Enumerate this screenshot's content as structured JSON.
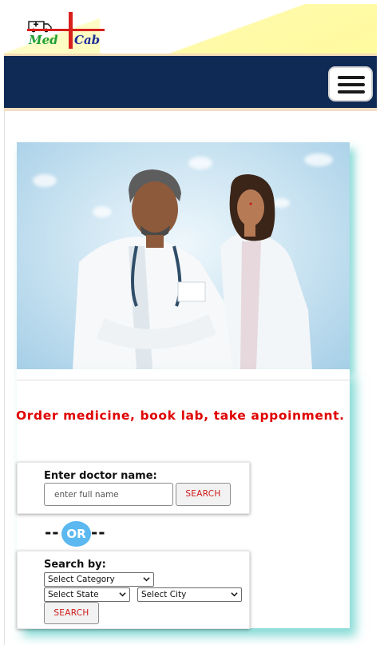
{
  "brand": {
    "logo_left": "Med",
    "logo_right": "Cab",
    "colors": {
      "med": "#1e9f31",
      "cab": "#1f2f96",
      "cross": "#d7201c"
    }
  },
  "navbar": {
    "color": "#0e2a55",
    "menu_icon": "hamburger-menu-icon"
  },
  "hero": {
    "image": "two-doctors-photo"
  },
  "tagline": "Order medicine, book lab, take appoinment.",
  "doctor_search": {
    "label": "Enter doctor name:",
    "placeholder": "enter full name",
    "button": "SEARCH"
  },
  "divider": {
    "left": "--",
    "text": "OR",
    "right": "--"
  },
  "search_by": {
    "label": "Search by:",
    "category": "Select Category",
    "state": "Select State",
    "city": "Select City",
    "button": "SEARCH"
  },
  "colors": {
    "accent_red": "#e00000",
    "or_circle": "#5bb8f0",
    "shadow_teal": "#28beb4"
  }
}
